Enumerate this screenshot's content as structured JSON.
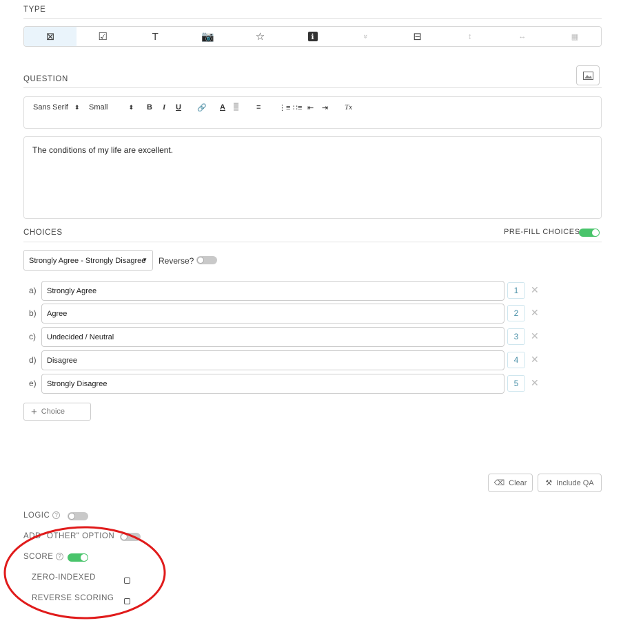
{
  "type_section": {
    "label": "TYPE",
    "buttons": [
      {
        "icon": "checkbox-x-icon",
        "glyph": "⊠",
        "active": true
      },
      {
        "icon": "checkbox-check-icon",
        "glyph": "☑"
      },
      {
        "icon": "text-icon",
        "glyph": "T"
      },
      {
        "icon": "camera-icon",
        "glyph": "📷"
      },
      {
        "icon": "star-icon",
        "glyph": "☆"
      },
      {
        "icon": "info-icon",
        "glyph": "ℹ"
      },
      {
        "icon": "double-chevron-down-icon",
        "glyph": "»",
        "faint": true
      },
      {
        "icon": "layout-icon",
        "glyph": "⊟"
      },
      {
        "icon": "vertical-resize-icon",
        "glyph": "↕",
        "faint": true
      },
      {
        "icon": "horizontal-resize-icon",
        "glyph": "↔",
        "faint": true
      },
      {
        "icon": "grid-image-icon",
        "glyph": "▦",
        "faint": true
      }
    ]
  },
  "question": {
    "label": "QUESTION",
    "text": "The conditions of my life are excellent.",
    "toolbar": {
      "font": "Sans Serif",
      "size": "Small",
      "bold": "B",
      "italic": "I",
      "underline": "U",
      "clear": "Tx"
    }
  },
  "choices": {
    "label": "CHOICES",
    "prefill_label": "PRE-FILL CHOICES?",
    "prefill_on": true,
    "preset": "Strongly Agree - Strongly Disagree",
    "reverse_label": "Reverse?",
    "items": [
      {
        "letter": "a)",
        "text": "Strongly Agree",
        "value": "1"
      },
      {
        "letter": "b)",
        "text": "Agree",
        "value": "2"
      },
      {
        "letter": "c)",
        "text": "Undecided / Neutral",
        "value": "3"
      },
      {
        "letter": "d)",
        "text": "Disagree",
        "value": "4"
      },
      {
        "letter": "e)",
        "text": "Strongly Disagree",
        "value": "5"
      }
    ],
    "add_label": "Choice"
  },
  "actions": {
    "clear_label": "Clear",
    "include_qa_label": "Include QA"
  },
  "options": {
    "logic_label": "LOGIC",
    "other_label": "ADD \"OTHER\" OPTION",
    "score_label": "SCORE",
    "zero_indexed_label": "ZERO-INDEXED",
    "reverse_scoring_label": "REVERSE SCORING"
  },
  "colors": {
    "toggle_on": "#49c46b",
    "annotation": "#e01b1b"
  }
}
